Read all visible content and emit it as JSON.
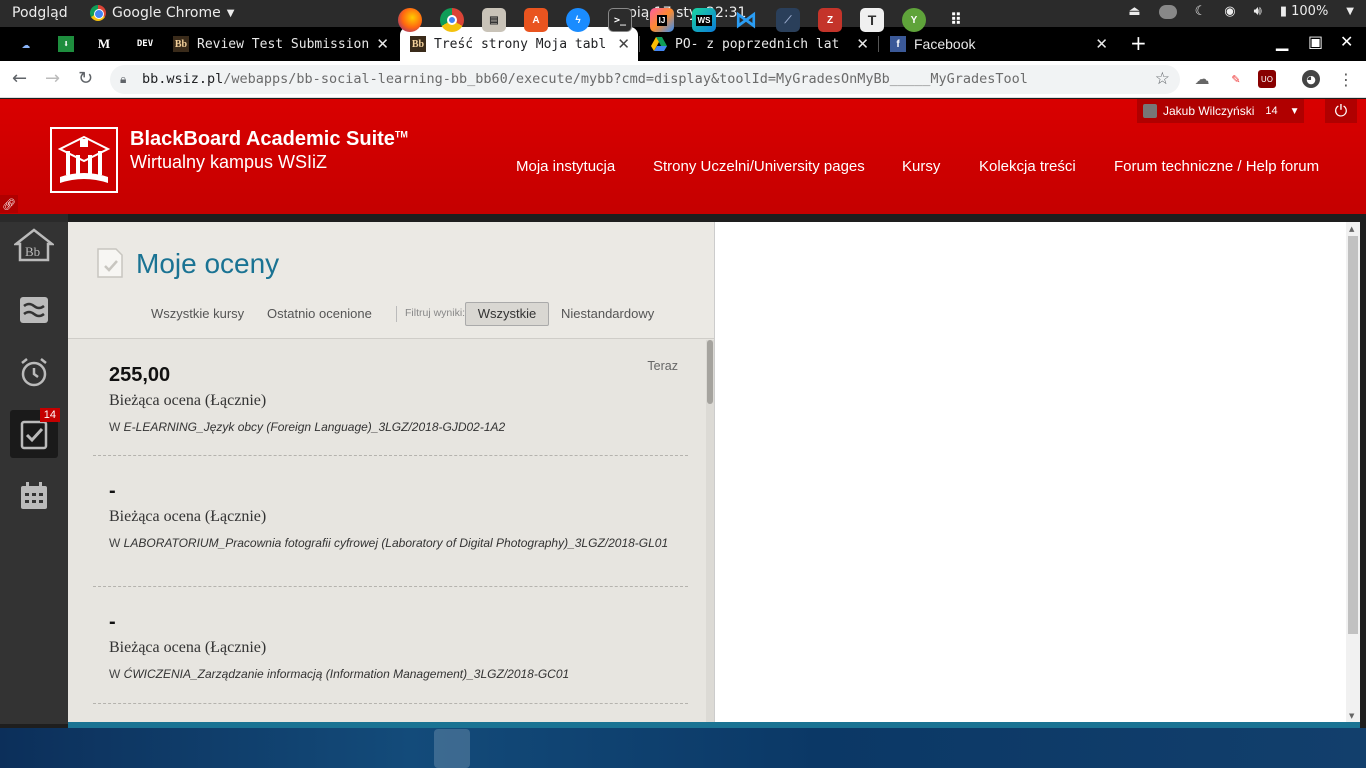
{
  "os": {
    "activities": "Podgląd",
    "app_name": "Google Chrome",
    "clock": "pią 17 sty, 22:31",
    "battery": "100%"
  },
  "tabs": [
    {
      "title": "",
      "favicon": "cloud-icon",
      "color": "#8ab4f8"
    },
    {
      "title": "",
      "favicon": "download-icon",
      "color": "#1e8e3e"
    },
    {
      "title": "",
      "favicon": "M",
      "color": "#000"
    },
    {
      "title": "",
      "favicon": "DEV",
      "color": "#000"
    },
    {
      "title": "Review Test Submission",
      "favicon": "Bb"
    },
    {
      "title": "Treść strony Moja tabl",
      "favicon": "Bb"
    },
    {
      "title": "PO- z poprzednich lat",
      "favicon": "drive-icon"
    },
    {
      "title": "Facebook",
      "favicon": "f"
    }
  ],
  "address": {
    "host": "bb.wsiz.pl",
    "path": "/webapps/bb-social-learning-bb_bb60/execute/mybb?cmd=display&toolId=MyGradesOnMyBb_____MyGradesTool"
  },
  "header": {
    "title": "BlackBoard Academic Suite",
    "tm": "TM",
    "subtitle": "Wirtualny kampus WSIiZ",
    "nav": [
      "Moja instytucja",
      "Strony Uczelni/University pages",
      "Kursy",
      "Kolekcja treści",
      "Forum techniczne / Help forum"
    ],
    "user": "Jakub Wilczyński",
    "notifications": "14"
  },
  "rail": {
    "grades_badge": "14"
  },
  "grades_page": {
    "title": "Moje oceny",
    "filters": {
      "all_courses": "Wszystkie kursy",
      "recently_graded": "Ostatnio ocenione",
      "filter_label": "Filtruj wyniki:",
      "all": "Wszystkie",
      "custom": "Niestandardowy"
    },
    "items": [
      {
        "score": "255,00",
        "label": "Bieżąca ocena (Łącznie)",
        "prefix": "W",
        "course": "E-LEARNING_Język obcy (Foreign Language)_3LGZ/2018-GJD02-1A2",
        "when": "Teraz"
      },
      {
        "score": "-",
        "label": "Bieżąca ocena (Łącznie)",
        "prefix": "W",
        "course": "LABORATORIUM_Pracownia fotografii cyfrowej (Laboratory of Digital Photography)_3LGZ/2018-GL01",
        "when": ""
      },
      {
        "score": "-",
        "label": "Bieżąca ocena (Łącznie)",
        "prefix": "W",
        "course": "ĆWICZENIA_Zarządzanie informacją (Information Management)_3LGZ/2018-GC01",
        "when": ""
      }
    ]
  },
  "colors": {
    "header_red": "#cc0000",
    "title_teal": "#1a7393"
  }
}
